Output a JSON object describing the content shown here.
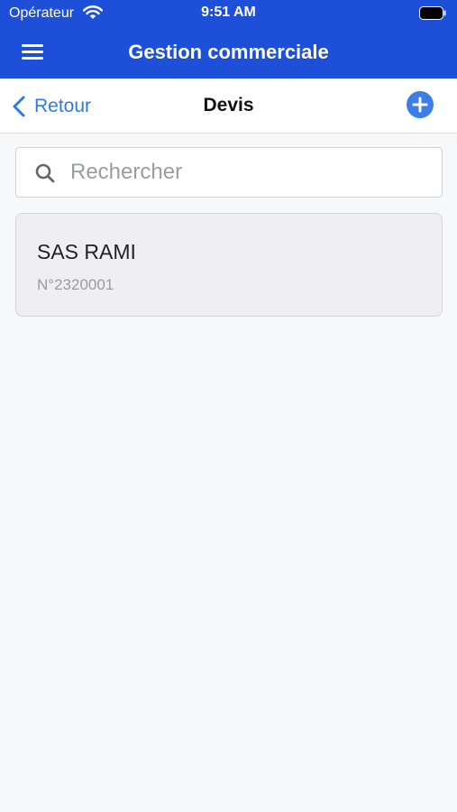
{
  "status_bar": {
    "carrier": "Opérateur",
    "time": "9:51 AM"
  },
  "app_header": {
    "title": "Gestion commerciale"
  },
  "nav": {
    "back_label": "Retour",
    "title": "Devis"
  },
  "search": {
    "placeholder": "Rechercher",
    "value": ""
  },
  "quotes": [
    {
      "client": "SAS RAMI",
      "number": "N°2320001"
    }
  ],
  "colors": {
    "header": "#1e4fd8",
    "accent": "#2c7be5",
    "add_button": "#3b7ee8",
    "background": "#f7f8fa"
  }
}
